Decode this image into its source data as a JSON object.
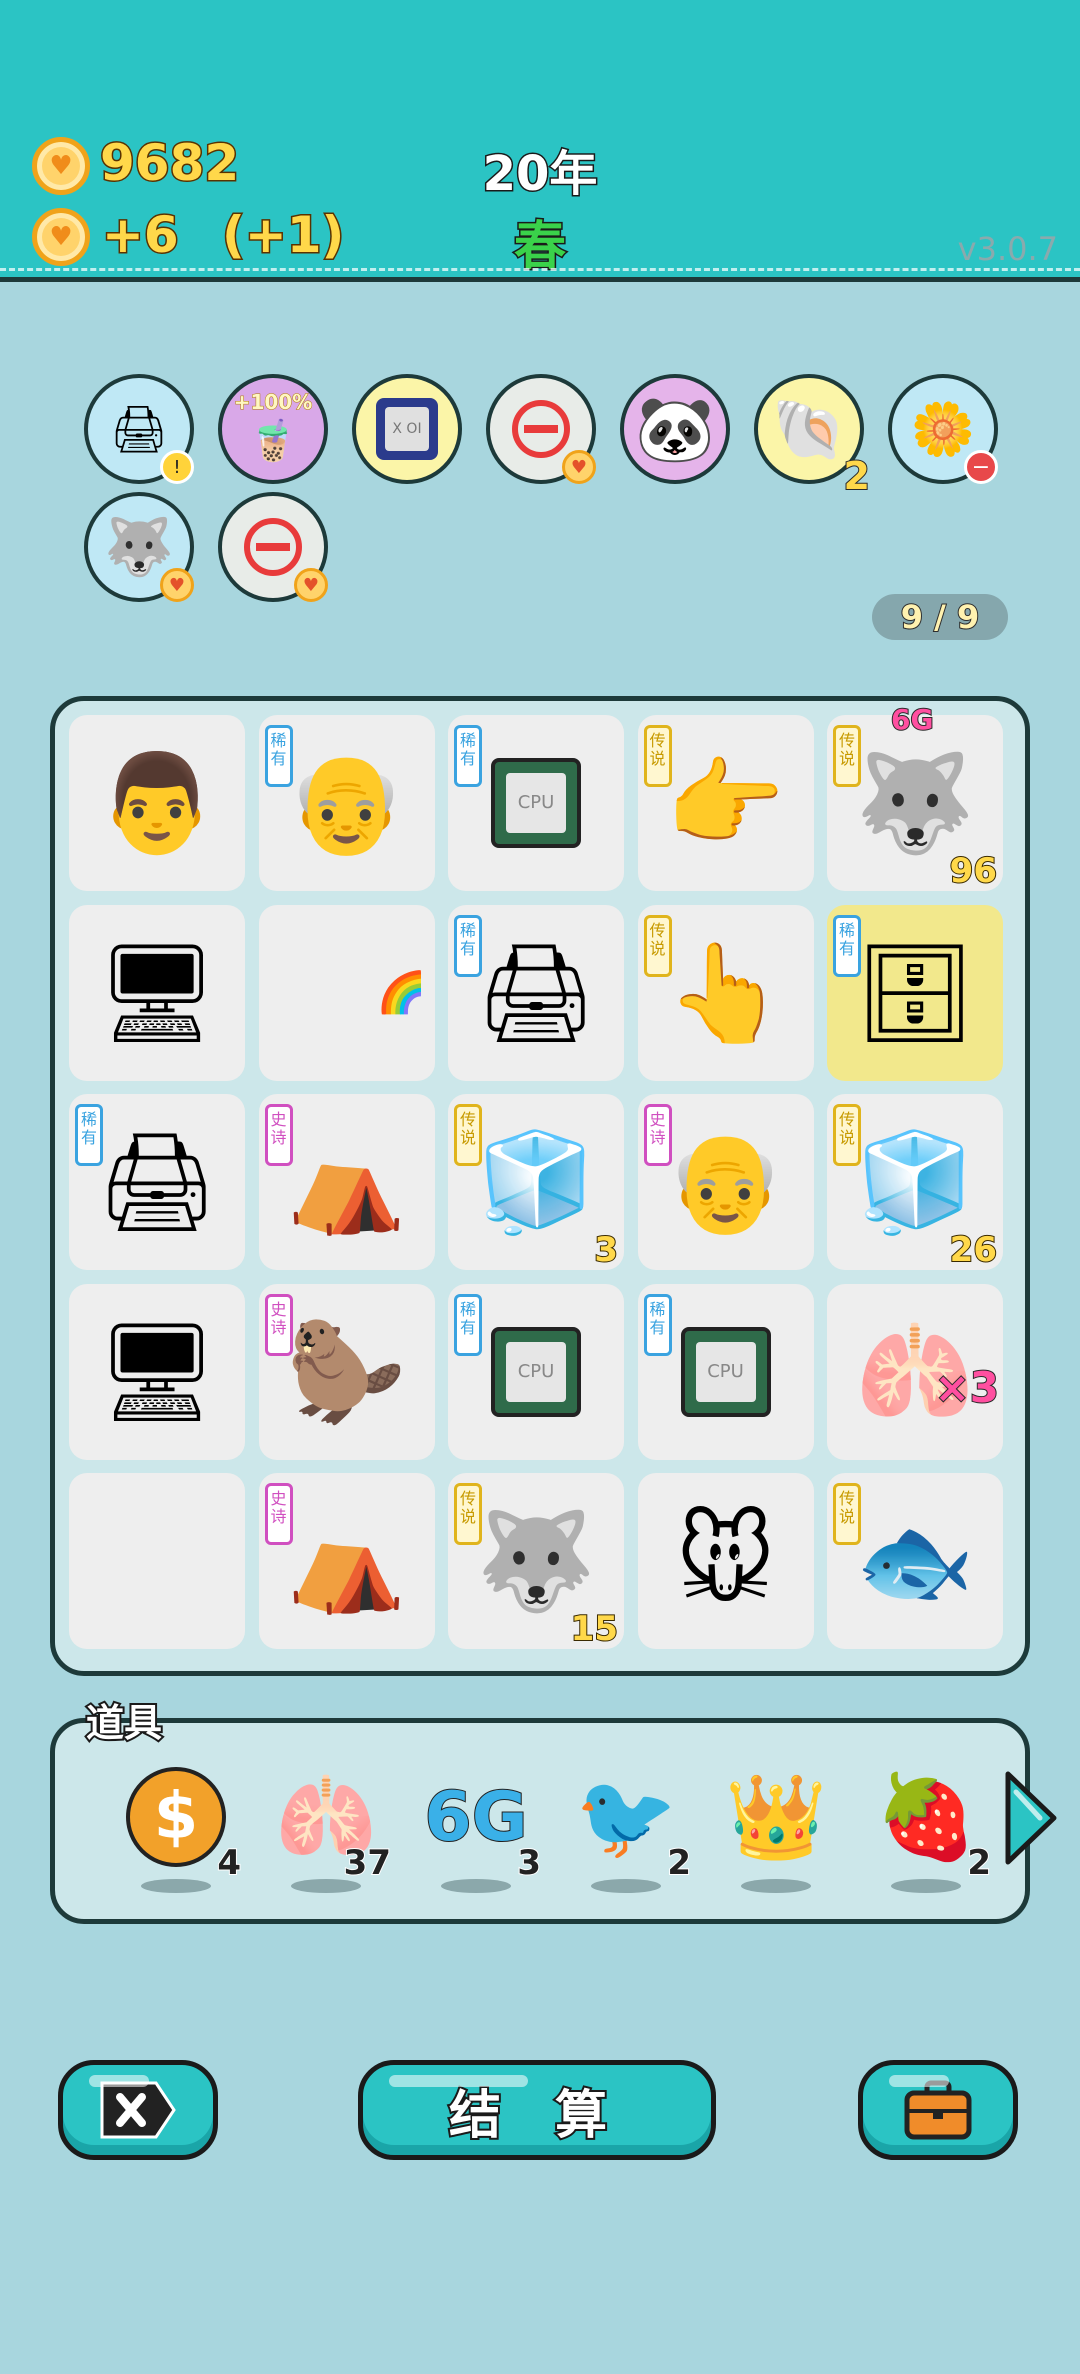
{
  "header": {
    "coins": "9682",
    "income": "+6",
    "income_bonus": "(+1)",
    "year": "20年",
    "season": "春",
    "version": "v3.0.7"
  },
  "status_effects": [
    {
      "icon": "printer-warning-icon",
      "count": ""
    },
    {
      "icon": "milk-tea-icon",
      "label": "+100%"
    },
    {
      "icon": "chip-icon",
      "label": "X OI"
    },
    {
      "icon": "minus-coin-icon",
      "count": ""
    },
    {
      "icon": "panda-icon",
      "count": ""
    },
    {
      "icon": "shell-icon",
      "count": "2"
    },
    {
      "icon": "potted-flower-icon",
      "count": ""
    },
    {
      "icon": "husky-coin-icon",
      "count": ""
    },
    {
      "icon": "minus-coin-icon",
      "count": ""
    }
  ],
  "slot_counter": "9 / 9",
  "board": {
    "rows": [
      [
        {
          "name": "man-face",
          "tag": "",
          "art": "👨",
          "count": ""
        },
        {
          "name": "bald-man",
          "tag": "稀有",
          "tag_type": "rare",
          "art": "👴",
          "count": ""
        },
        {
          "name": "cpu-chip",
          "tag": "稀有",
          "tag_type": "rare",
          "art": "CPU",
          "count": ""
        },
        {
          "name": "pointing-hand",
          "tag": "传说",
          "tag_type": "legend",
          "art": "👉",
          "count": ""
        },
        {
          "name": "husky-6g",
          "tag": "传说",
          "tag_type": "legend",
          "art": "🐺",
          "count": "96",
          "badge": "6G"
        }
      ],
      [
        {
          "name": "monitor",
          "tag": "",
          "art": "🖥",
          "count": ""
        },
        {
          "name": "empty-rainbow",
          "tag": "",
          "art": "🌈",
          "count": ""
        },
        {
          "name": "printer",
          "tag": "稀有",
          "tag_type": "rare",
          "art": "🖨",
          "count": ""
        },
        {
          "name": "pointing-hand-up",
          "tag": "传说",
          "tag_type": "legend",
          "art": "👆",
          "count": ""
        },
        {
          "name": "server-tower",
          "tag": "稀有",
          "tag_type": "rare",
          "art": "🗄",
          "count": "",
          "highlight": true
        }
      ],
      [
        {
          "name": "printer",
          "tag": "稀有",
          "tag_type": "rare",
          "art": "🖨",
          "count": ""
        },
        {
          "name": "rabbit-tent",
          "tag": "史诗",
          "tag_type": "epic",
          "art": "⛺",
          "count": ""
        },
        {
          "name": "fridge-heal",
          "tag": "传说",
          "tag_type": "legend",
          "art": "🧊",
          "count": "3"
        },
        {
          "name": "old-man",
          "tag": "史诗",
          "tag_type": "epic",
          "art": "👴",
          "count": ""
        },
        {
          "name": "fridge",
          "tag": "传说",
          "tag_type": "legend",
          "art": "🧊",
          "count": "26"
        }
      ],
      [
        {
          "name": "monitor",
          "tag": "",
          "art": "🖥",
          "count": ""
        },
        {
          "name": "otter",
          "tag": "史诗",
          "tag_type": "epic",
          "art": "🦫",
          "count": ""
        },
        {
          "name": "cpu-chip",
          "tag": "稀有",
          "tag_type": "rare",
          "art": "CPU",
          "count": ""
        },
        {
          "name": "cpu-chip-rainbow",
          "tag": "稀有",
          "tag_type": "rare",
          "art": "CPU",
          "count": ""
        },
        {
          "name": "liver-x3",
          "tag": "",
          "art": "🫁",
          "count": "",
          "badge": "×3"
        }
      ],
      [
        {
          "name": "empty",
          "tag": "",
          "art": "",
          "count": ""
        },
        {
          "name": "rabbit-tent",
          "tag": "史诗",
          "tag_type": "epic",
          "art": "⛺",
          "count": ""
        },
        {
          "name": "husky-king",
          "tag": "传说",
          "tag_type": "legend",
          "art": "🐺",
          "count": "15"
        },
        {
          "name": "mouse",
          "tag": "",
          "art": "🐭",
          "count": ""
        },
        {
          "name": "koi-fish",
          "tag": "传说",
          "tag_type": "legend",
          "art": "🐟",
          "count": ""
        }
      ]
    ]
  },
  "items_panel": {
    "title": "道具",
    "items": [
      {
        "name": "dollar-coin",
        "icon": "$",
        "count": "4"
      },
      {
        "name": "liver",
        "icon": "🫁",
        "count": "37"
      },
      {
        "name": "6g",
        "icon": "6G",
        "count": "3"
      },
      {
        "name": "white-bird",
        "icon": "🐦",
        "count": "2"
      },
      {
        "name": "crown",
        "icon": "👑",
        "count": ""
      },
      {
        "name": "strawberry",
        "icon": "🍓",
        "count": "2"
      }
    ]
  },
  "buttons": {
    "settle_label": "结 算"
  },
  "colors": {
    "header_bg": "#2bc4c4",
    "page_bg": "#a8d6de",
    "coin_text": "#ffd84a",
    "season_text": "#3ad24a",
    "tag_rare": "#3aa3e0",
    "tag_epic": "#d04fc0",
    "tag_legend": "#e0b41c"
  }
}
